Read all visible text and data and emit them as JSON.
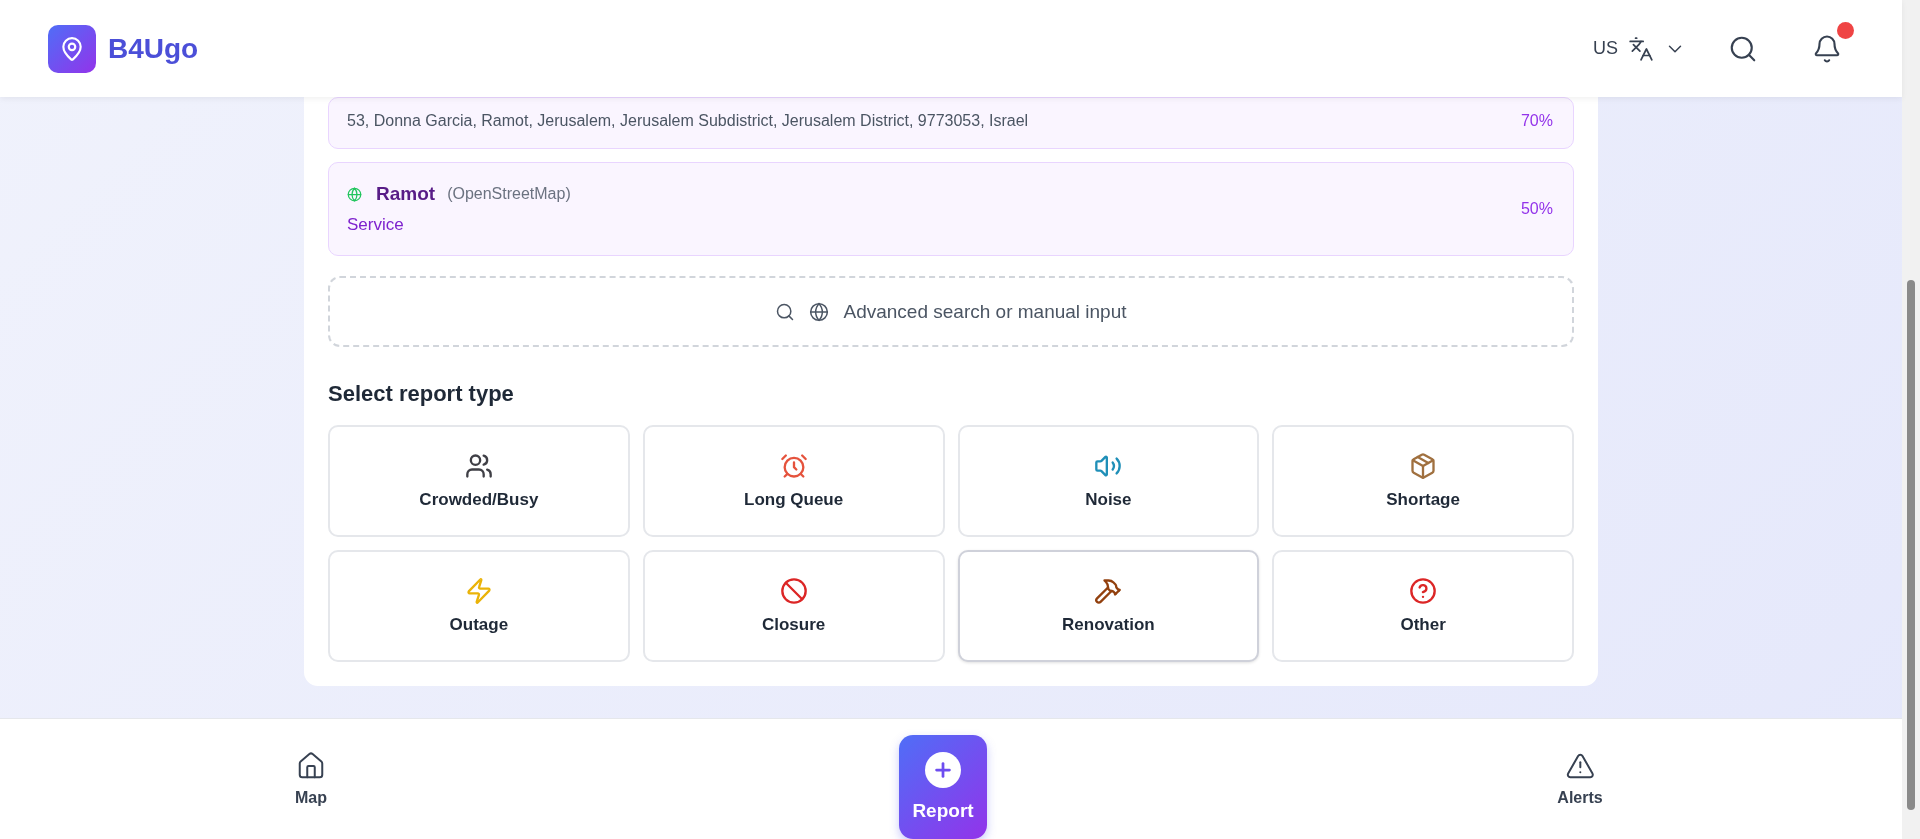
{
  "header": {
    "logo": "B4Ugo",
    "language": "US",
    "notification_dot": true
  },
  "results": [
    {
      "address": "53, Donna Garcia, Ramot, Jerusalem, Jerusalem Subdistrict, Jerusalem District, 9773053, Israel",
      "percent": "70%"
    },
    {
      "title": "Ramot",
      "source": "(OpenStreetMap)",
      "category": "Service",
      "percent": "50%"
    }
  ],
  "advanced_search": "Advanced search or manual input",
  "report_heading": "Select report type",
  "report_types": [
    {
      "kind": "crowded",
      "label": "Crowded/Busy",
      "selected": false
    },
    {
      "kind": "queue",
      "label": "Long Queue",
      "selected": false
    },
    {
      "kind": "noise",
      "label": "Noise",
      "selected": false
    },
    {
      "kind": "shortage",
      "label": "Shortage",
      "selected": false
    },
    {
      "kind": "outage",
      "label": "Outage",
      "selected": false
    },
    {
      "kind": "closure",
      "label": "Closure",
      "selected": false
    },
    {
      "kind": "renovation",
      "label": "Renovation",
      "selected": true
    },
    {
      "kind": "other",
      "label": "Other",
      "selected": false
    }
  ],
  "bottom_nav": [
    {
      "kind": "map",
      "label": "Map"
    },
    {
      "kind": "report",
      "label": "Report"
    },
    {
      "kind": "alerts",
      "label": "Alerts"
    }
  ]
}
